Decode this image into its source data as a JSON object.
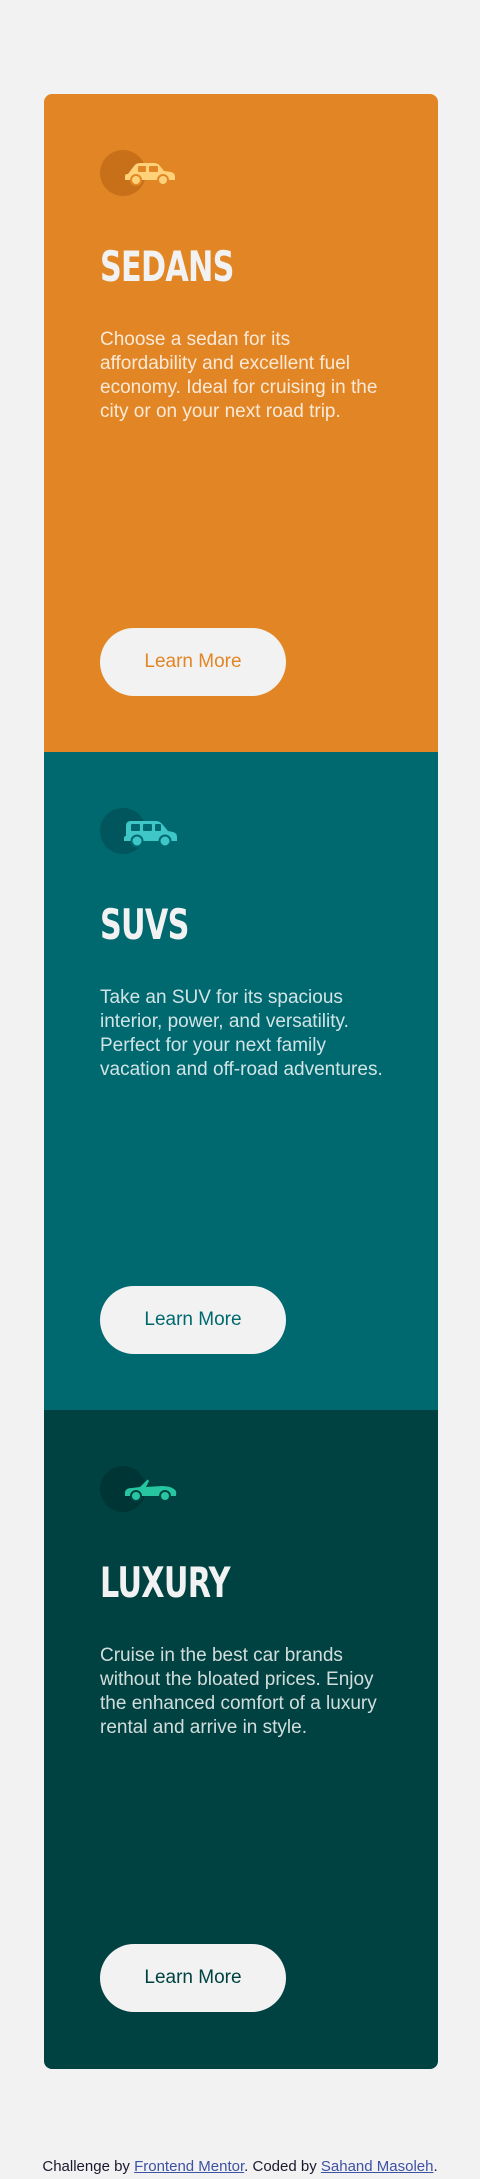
{
  "cards": [
    {
      "icon": "sedan-car-icon",
      "title": "Sedans",
      "text": "Choose a sedan for its affordability and excellent fuel economy. Ideal for cruising in the city or on your next road trip.",
      "button_label": "Learn More",
      "accent": "#e28625"
    },
    {
      "icon": "suv-car-icon",
      "title": "SUVs",
      "text": "Take an SUV for its spacious interior, power, and versatility. Perfect for your next family vacation and off-road adventures.",
      "button_label": "Learn More",
      "accent": "#006970"
    },
    {
      "icon": "luxury-car-icon",
      "title": "Luxury",
      "text": "Cruise in the best car brands without the bloated prices. Enjoy the enhanced comfort of a luxury rental and arrive in style.",
      "button_label": "Learn More",
      "accent": "#004241"
    }
  ],
  "footer": {
    "prefix": "Challenge by ",
    "challenge_link": "Frontend Mentor",
    "middle": ". Coded by ",
    "author_link": "Sahand Masoleh",
    "suffix": "."
  },
  "colors": {
    "background": "#f2f2f2",
    "button": "#f2f2f2",
    "text": "#f2f2f2"
  }
}
